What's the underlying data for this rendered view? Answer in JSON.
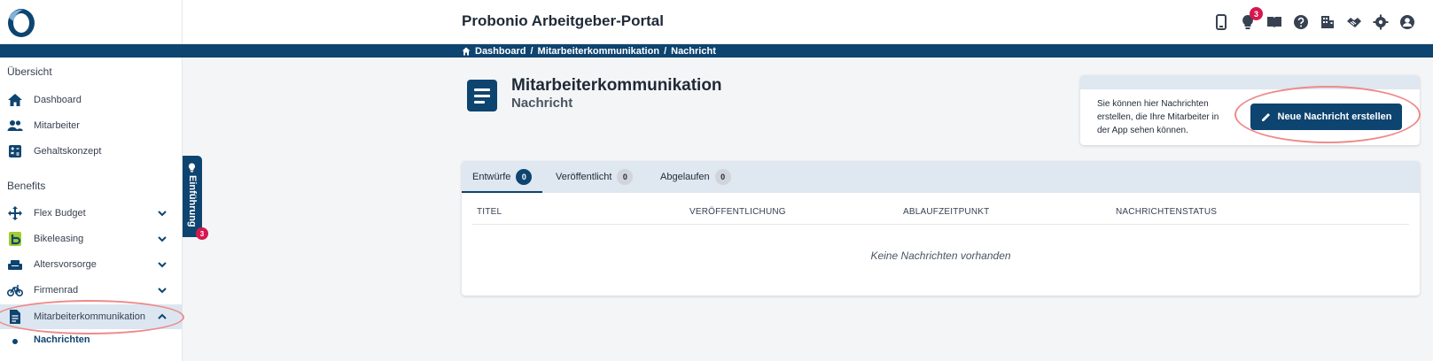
{
  "header": {
    "title": "Probonio Arbeitgeber-Portal",
    "notification_count": "3",
    "icons": [
      "phone-icon",
      "lightbulb-icon",
      "book-icon",
      "help-icon",
      "building-icon",
      "handshake-icon",
      "settings-icon",
      "account-icon"
    ]
  },
  "breadcrumb": {
    "items": [
      "Dashboard",
      "Mitarbeiterkommunikation",
      "Nachricht"
    ],
    "separator": "/"
  },
  "sidebar": {
    "sections": [
      {
        "title": "Übersicht",
        "items": [
          {
            "label": "Dashboard",
            "icon": "home-icon"
          },
          {
            "label": "Mitarbeiter",
            "icon": "people-icon"
          },
          {
            "label": "Gehaltskonzept",
            "icon": "calculator-icon"
          }
        ]
      },
      {
        "title": "Benefits",
        "items": [
          {
            "label": "Flex Budget",
            "icon": "arrows-icon",
            "expandable": true
          },
          {
            "label": "Bikeleasing",
            "icon": "bikeleasing-icon",
            "expandable": true
          },
          {
            "label": "Altersvorsorge",
            "icon": "sofa-icon",
            "expandable": true
          },
          {
            "label": "Firmenrad",
            "icon": "bicycle-icon",
            "expandable": true
          },
          {
            "label": "Mitarbeiterkommunikation",
            "icon": "document-icon",
            "expandable": true,
            "expanded": true,
            "active": true
          }
        ]
      }
    ],
    "sub_item": "Nachrichten"
  },
  "intro_tab": {
    "label": "Einführung",
    "count": "3"
  },
  "page": {
    "title": "Mitarbeiterkommunikation",
    "subtitle": "Nachricht"
  },
  "info_card": {
    "text": "Sie können hier Nachrichten erstellen, die Ihre Mitarbeiter in der App sehen können.",
    "button_label": "Neue Nachricht erstellen"
  },
  "tabs": [
    {
      "label": "Entwürfe",
      "count": "0",
      "active": true
    },
    {
      "label": "Veröffentlicht",
      "count": "0",
      "active": false
    },
    {
      "label": "Abgelaufen",
      "count": "0",
      "active": false
    }
  ],
  "table": {
    "columns": [
      "TITEL",
      "VERÖFFENTLICHUNG",
      "ABLAUFZEITPUNKT",
      "NACHRICHTENSTATUS"
    ],
    "empty_message": "Keine Nachrichten vorhanden"
  },
  "colors": {
    "primary": "#0e4470",
    "badge": "#d6184f",
    "highlight": "#ef8a8a",
    "tab_bar": "#dfe7f0"
  }
}
